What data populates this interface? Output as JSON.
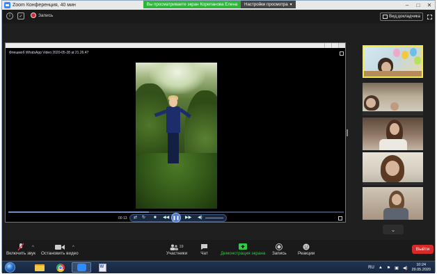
{
  "window": {
    "title": "Zoom Конференция, 40 мин"
  },
  "share_banner": {
    "status": "Вы просматриваете экран Корепанова Елена",
    "options_label": "Настройки просмотра"
  },
  "top_bar": {
    "recording_label": "Запись",
    "view_button_label": "Вид:докладчика"
  },
  "shared_window": {
    "video_title": "Флешмоб WhatsApp Video 2020-05-28 at 21.26.47",
    "current_time": "00:13",
    "progress_fraction": 0.42
  },
  "toolbar": {
    "mute_label": "Включить звук",
    "video_label": "Остановить видео",
    "participants_label": "Участники",
    "participants_count": "19",
    "chat_label": "Чат",
    "share_label": "Демонстрация экрана",
    "record_label": "Запись",
    "reactions_label": "Реакции",
    "leave_label": "Выйти"
  },
  "taskbar": {
    "language": "RU",
    "time": "10:24",
    "date": "29.05.2020"
  },
  "colors": {
    "share_green": "#2eb43a",
    "leave_red": "#d52a2a",
    "active_speaker_border": "#f4e94a",
    "zoom_blue": "#2d8cff"
  },
  "icons": [
    "zoom-app-icon",
    "info-icon",
    "shield-icon",
    "record-dot-icon",
    "grid-view-icon",
    "fullscreen-icon",
    "microphone-muted-icon",
    "camera-icon",
    "participants-icon",
    "chat-icon",
    "share-screen-icon",
    "record-icon",
    "reactions-icon",
    "chevron-down-icon",
    "start-orb-icon",
    "folder-icon",
    "chrome-icon",
    "zoom-taskbar-icon",
    "word-doc-icon"
  ]
}
